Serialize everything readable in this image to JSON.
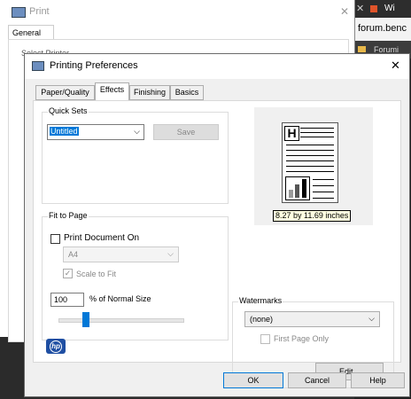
{
  "browser": {
    "tab_label": "Wi",
    "url_text": "forum.benc",
    "bookmark_label": "Forumi"
  },
  "print_dialog": {
    "title": "Print",
    "tab_general": "General",
    "section_partial": "Select Printer"
  },
  "prefs": {
    "title": "Printing Preferences",
    "tabs": [
      "Paper/Quality",
      "Effects",
      "Finishing",
      "Basics"
    ],
    "selected_tab": "Effects",
    "quick_sets": {
      "label": "Quick Sets",
      "value": "Untitled",
      "save_label": "Save"
    },
    "preview": {
      "dimensions": "8.27 by 11.69 inches"
    },
    "fit_to_page": {
      "label": "Fit to Page",
      "print_document_on_label": "Print Document On",
      "print_document_on_checked": false,
      "paper_value": "A4",
      "scale_to_fit_label": "Scale to Fit",
      "scale_to_fit_checked": true,
      "percent_value": "100",
      "percent_label": "% of Normal Size",
      "slider_level": 0.22
    },
    "watermarks": {
      "label": "Watermarks",
      "value": "(none)",
      "first_page_only_label": "First Page Only",
      "edit_label": "Edit..."
    },
    "logo_text": "hp",
    "buttons": {
      "ok": "OK",
      "cancel": "Cancel",
      "help": "Help"
    }
  }
}
